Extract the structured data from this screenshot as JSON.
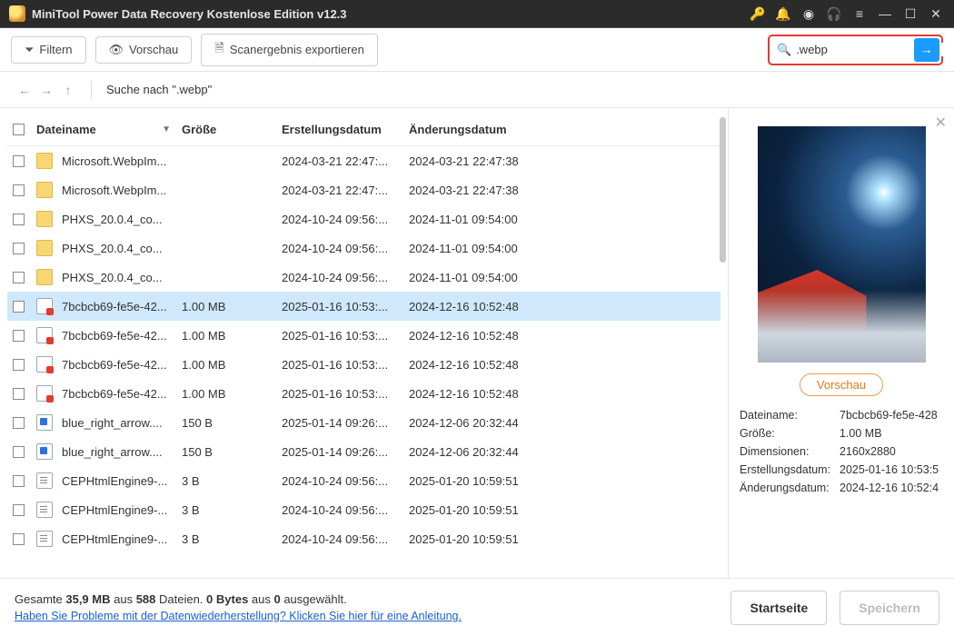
{
  "app": {
    "title": "MiniTool Power Data Recovery Kostenlose Edition v12.3"
  },
  "toolbar": {
    "filter": "Filtern",
    "preview": "Vorschau",
    "export": "Scanergebnis exportieren"
  },
  "search": {
    "value": ".webp"
  },
  "nav": {
    "path": "Suche nach \".webp\""
  },
  "columns": {
    "name": "Dateiname",
    "size": "Größe",
    "created": "Erstellungsdatum",
    "modified": "Änderungsdatum"
  },
  "rows": [
    {
      "icon": "folder",
      "name": "Microsoft.WebpIm...",
      "size": "",
      "created": "2024-03-21 22:47:...",
      "modified": "2024-03-21 22:47:38"
    },
    {
      "icon": "folder",
      "name": "Microsoft.WebpIm...",
      "size": "",
      "created": "2024-03-21 22:47:...",
      "modified": "2024-03-21 22:47:38"
    },
    {
      "icon": "folder",
      "name": "PHXS_20.0.4_co...",
      "size": "",
      "created": "2024-10-24 09:56:...",
      "modified": "2024-11-01 09:54:00"
    },
    {
      "icon": "folder",
      "name": "PHXS_20.0.4_co...",
      "size": "",
      "created": "2024-10-24 09:56:...",
      "modified": "2024-11-01 09:54:00"
    },
    {
      "icon": "folder",
      "name": "PHXS_20.0.4_co...",
      "size": "",
      "created": "2024-10-24 09:56:...",
      "modified": "2024-11-01 09:54:00"
    },
    {
      "icon": "webp",
      "name": "7bcbcb69-fe5e-42...",
      "size": "1.00 MB",
      "created": "2025-01-16 10:53:...",
      "modified": "2024-12-16 10:52:48",
      "selected": true
    },
    {
      "icon": "webp",
      "name": "7bcbcb69-fe5e-42...",
      "size": "1.00 MB",
      "created": "2025-01-16 10:53:...",
      "modified": "2024-12-16 10:52:48"
    },
    {
      "icon": "webp",
      "name": "7bcbcb69-fe5e-42...",
      "size": "1.00 MB",
      "created": "2025-01-16 10:53:...",
      "modified": "2024-12-16 10:52:48"
    },
    {
      "icon": "webp",
      "name": "7bcbcb69-fe5e-42...",
      "size": "1.00 MB",
      "created": "2025-01-16 10:53:...",
      "modified": "2024-12-16 10:52:48"
    },
    {
      "icon": "blue",
      "name": "blue_right_arrow....",
      "size": "150 B",
      "created": "2025-01-14 09:26:...",
      "modified": "2024-12-06 20:32:44"
    },
    {
      "icon": "blue",
      "name": "blue_right_arrow....",
      "size": "150 B",
      "created": "2025-01-14 09:26:...",
      "modified": "2024-12-06 20:32:44"
    },
    {
      "icon": "txt",
      "name": "CEPHtmlEngine9-...",
      "size": "3 B",
      "created": "2024-10-24 09:56:...",
      "modified": "2025-01-20 10:59:51"
    },
    {
      "icon": "txt",
      "name": "CEPHtmlEngine9-...",
      "size": "3 B",
      "created": "2024-10-24 09:56:...",
      "modified": "2025-01-20 10:59:51"
    },
    {
      "icon": "txt",
      "name": "CEPHtmlEngine9-...",
      "size": "3 B",
      "created": "2024-10-24 09:56:...",
      "modified": "2025-01-20 10:59:51"
    }
  ],
  "preview": {
    "button": "Vorschau",
    "labels": {
      "name": "Dateiname:",
      "size": "Größe:",
      "dim": "Dimensionen:",
      "created": "Erstellungsdatum:",
      "modified": "Änderungsdatum:"
    },
    "values": {
      "name": "7bcbcb69-fe5e-428",
      "size": "1.00 MB",
      "dim": "2160x2880",
      "created": "2025-01-16 10:53:5",
      "modified": "2024-12-16 10:52:4"
    }
  },
  "footer": {
    "summary_prefix": "Gesamte ",
    "total_size": "35,9 MB",
    "summary_mid1": " aus ",
    "total_files": "588",
    "summary_mid2": " Dateien.  ",
    "sel_size": "0 Bytes",
    "summary_mid3": " aus ",
    "sel_count": "0",
    "summary_suffix": " ausgewählt.",
    "help": "Haben Sie Probleme mit der Datenwiederherstellung? Klicken Sie hier für eine Anleitung.",
    "home": "Startseite",
    "save": "Speichern"
  }
}
